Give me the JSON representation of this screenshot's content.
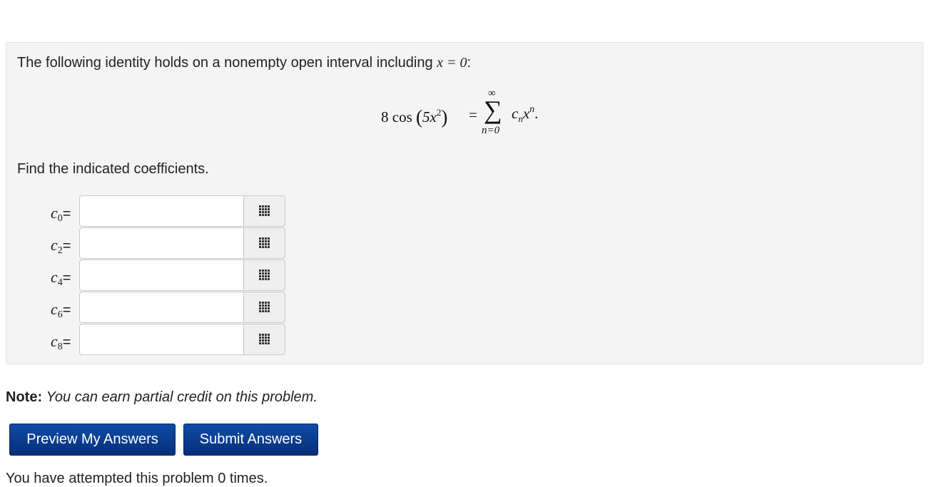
{
  "problem": {
    "intro_text": "The following identity holds on a nonempty open interval including",
    "intro_math": "x = 0",
    "intro_suffix": ":",
    "formula": {
      "lhs_coef": "8 cos",
      "lhs_inner": "5x",
      "lhs_exp": "2",
      "equals": "=",
      "sum_upper": "∞",
      "sum_lower": "n=0",
      "rhs_c": "c",
      "rhs_sub": "n",
      "rhs_x": "x",
      "rhs_exp": "n",
      "rhs_end": "."
    },
    "instruction": "Find the indicated coefficients."
  },
  "answers": [
    {
      "letter": "c",
      "index": "0",
      "suffix": "=",
      "value": ""
    },
    {
      "letter": "c",
      "index": "2",
      "suffix": "=",
      "value": ""
    },
    {
      "letter": "c",
      "index": "4",
      "suffix": "=",
      "value": ""
    },
    {
      "letter": "c",
      "index": "6",
      "suffix": "=",
      "value": ""
    },
    {
      "letter": "c",
      "index": "8",
      "suffix": "=",
      "value": ""
    }
  ],
  "note": {
    "label": "Note:",
    "text": "You can earn partial credit on this problem."
  },
  "buttons": {
    "preview": "Preview My Answers",
    "submit": "Submit Answers"
  },
  "attempts_text": "You have attempted this problem 0 times.",
  "icons": {
    "palette": "grid-icon"
  },
  "colors": {
    "panel_bg": "#f4f4f4",
    "button_bg": "#0b3a8c",
    "button_text": "#ffffff"
  }
}
